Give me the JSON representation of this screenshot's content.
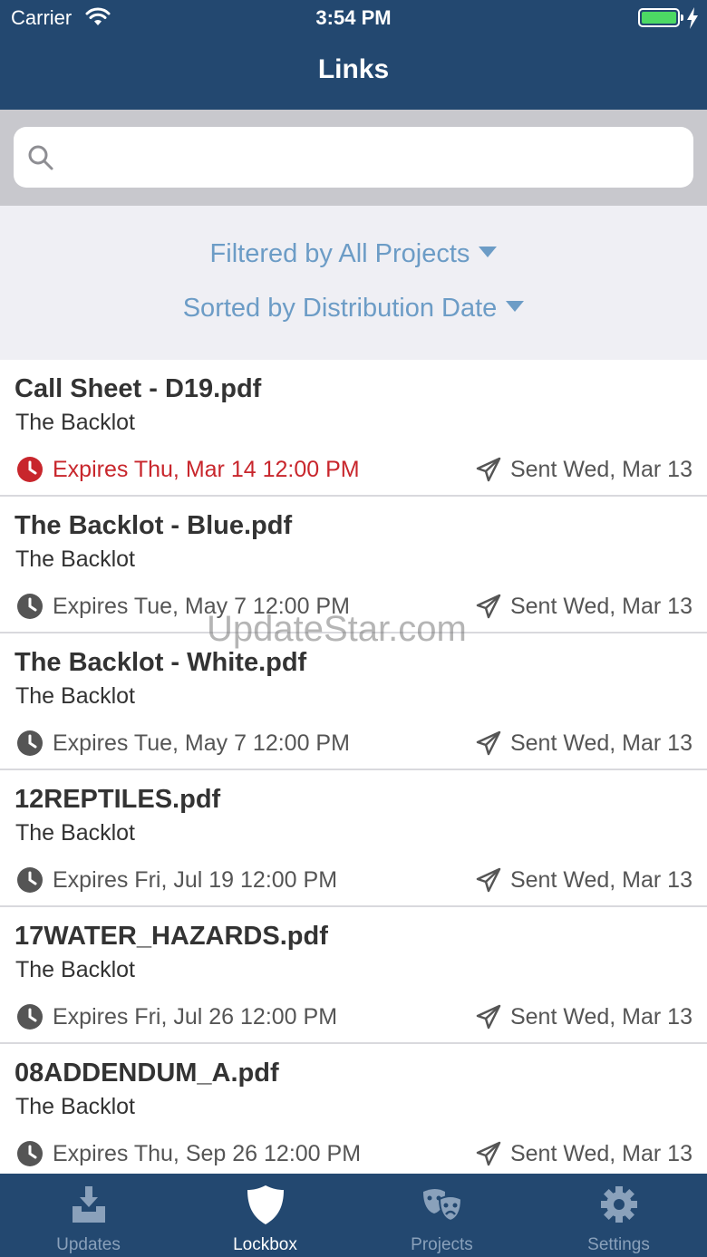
{
  "status_bar": {
    "carrier": "Carrier",
    "time": "3:54 PM"
  },
  "nav": {
    "title": "Links"
  },
  "search": {
    "placeholder": ""
  },
  "filters": {
    "project_filter": "Filtered by All Projects",
    "sort_order": "Sorted by Distribution Date"
  },
  "links": [
    {
      "title": "Call Sheet - D19.pdf",
      "project": "The Backlot",
      "expires": "Expires Thu, Mar 14 12:00 PM",
      "sent": "Sent Wed, Mar 13",
      "urgent": true
    },
    {
      "title": "The Backlot - Blue.pdf",
      "project": "The Backlot",
      "expires": "Expires Tue, May 7 12:00 PM",
      "sent": "Sent Wed, Mar 13",
      "urgent": false
    },
    {
      "title": "The Backlot - White.pdf",
      "project": "The Backlot",
      "expires": "Expires Tue, May 7 12:00 PM",
      "sent": "Sent Wed, Mar 13",
      "urgent": false
    },
    {
      "title": "12REPTILES.pdf",
      "project": "The Backlot",
      "expires": "Expires Fri, Jul 19 12:00 PM",
      "sent": "Sent Wed, Mar 13",
      "urgent": false
    },
    {
      "title": "17WATER_HAZARDS.pdf",
      "project": "The Backlot",
      "expires": "Expires Fri, Jul 26 12:00 PM",
      "sent": "Sent Wed, Mar 13",
      "urgent": false
    },
    {
      "title": "08ADDENDUM_A.pdf",
      "project": "The Backlot",
      "expires": "Expires Thu, Sep 26 12:00 PM",
      "sent": "Sent Wed, Mar 13",
      "urgent": false
    }
  ],
  "watermark": "UpdateStar.com",
  "tabs": [
    {
      "label": "Updates",
      "icon": "inbox-download-icon",
      "active": false
    },
    {
      "label": "Lockbox",
      "icon": "shield-icon",
      "active": true
    },
    {
      "label": "Projects",
      "icon": "theater-masks-icon",
      "active": false
    },
    {
      "label": "Settings",
      "icon": "gear-icon",
      "active": false
    }
  ],
  "colors": {
    "nav_background": "#234870",
    "filter_text": "#6c9cc6",
    "urgent_red": "#c8262c",
    "battery_green": "#4cd964"
  }
}
